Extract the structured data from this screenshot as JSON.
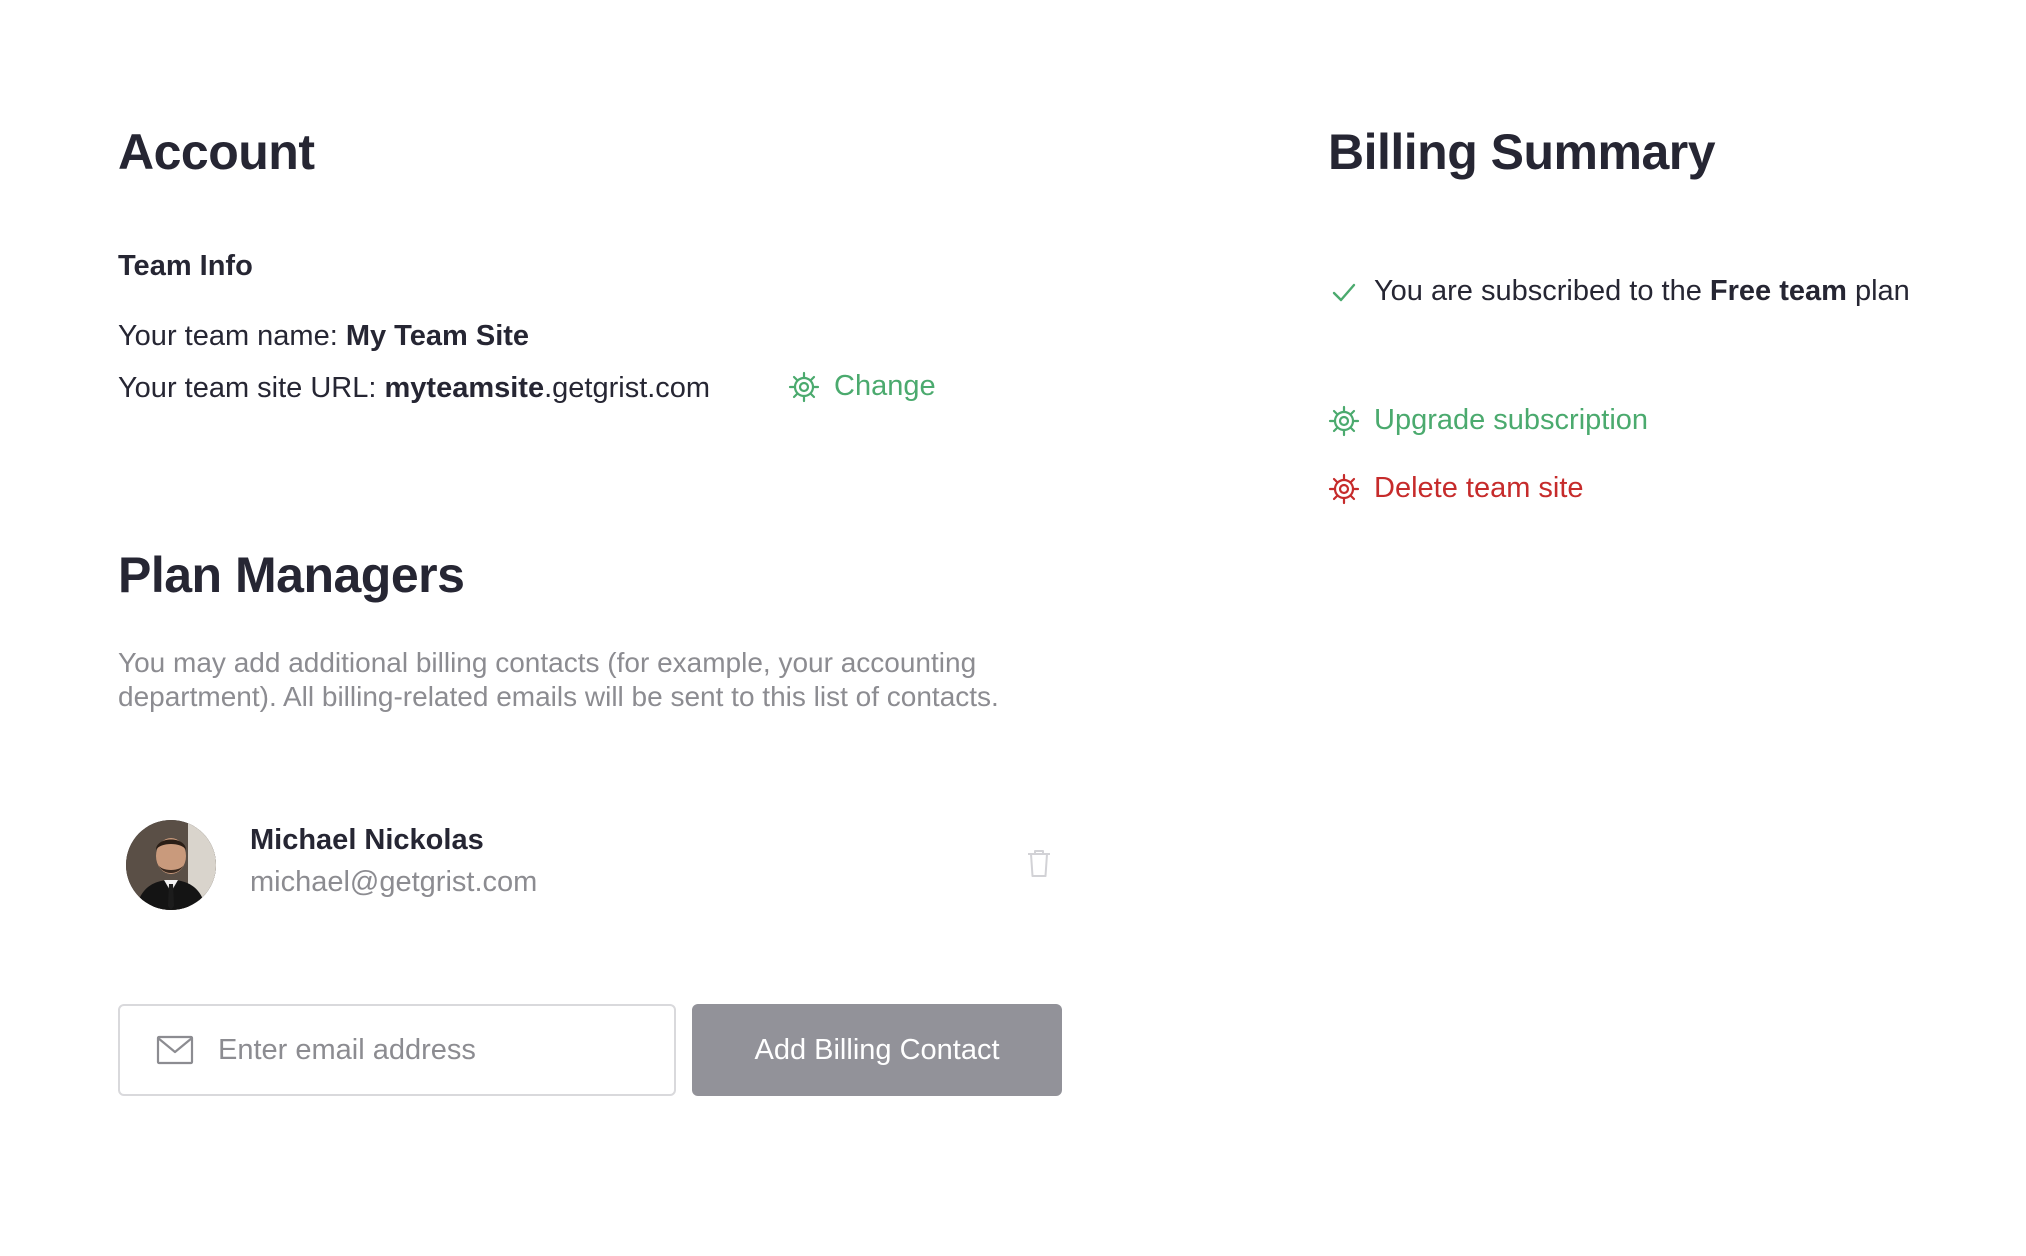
{
  "account": {
    "title": "Account",
    "team_info_heading": "Team Info",
    "team_name_prefix": "Your team name: ",
    "team_name": "My Team Site",
    "site_url_prefix": "Your team site URL: ",
    "site_subdomain": "myteamsite",
    "site_domain": ".getgrist.com",
    "change_label": "Change"
  },
  "plan_managers": {
    "title": "Plan Managers",
    "description": "You may add additional billing contacts (for example, your accounting department). All billing-related emails will be sent to this list of contacts.",
    "contacts": [
      {
        "name": "Michael Nickolas",
        "email": "michael@getgrist.com"
      }
    ],
    "email_placeholder": "Enter email address",
    "add_button_label": "Add Billing Contact"
  },
  "billing": {
    "title": "Billing Summary",
    "subscribed_prefix": "You are subscribed to the ",
    "plan_name": "Free team",
    "subscribed_suffix": " plan",
    "upgrade_label": "Upgrade subscription",
    "delete_label": "Delete team site"
  },
  "colors": {
    "accent_green": "#4baa6e",
    "danger_red": "#c62b2b",
    "muted_gray": "#8c8c91",
    "button_gray": "#929299"
  },
  "icons": {
    "change": "gear-icon",
    "upgrade": "gear-icon",
    "delete": "gear-icon",
    "subscribed": "checkmark-icon",
    "email": "envelope-icon",
    "remove_contact": "trash-icon"
  }
}
